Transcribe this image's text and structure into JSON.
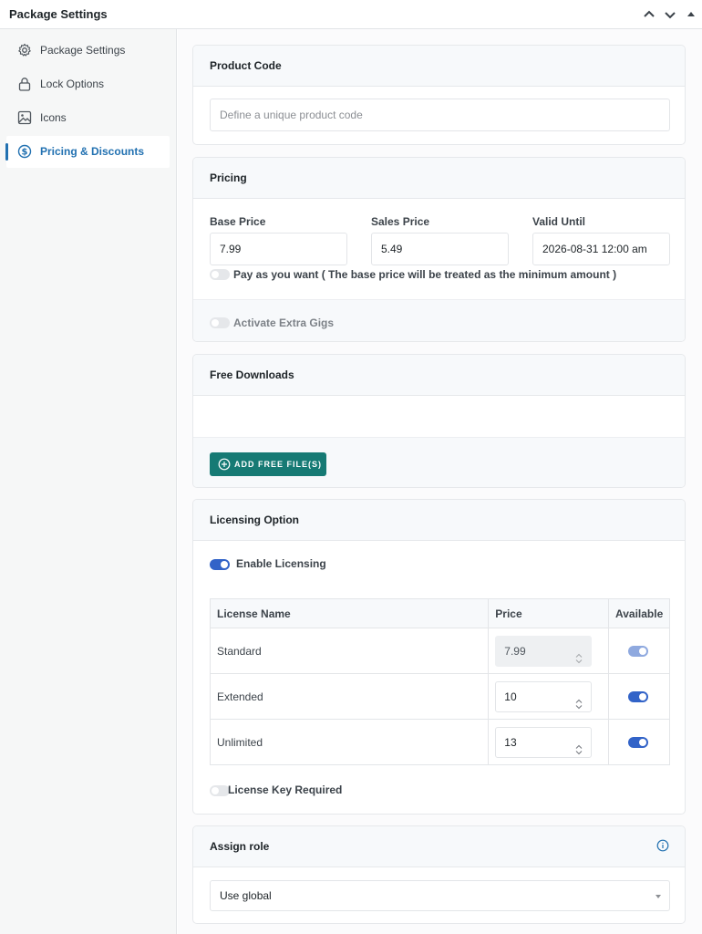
{
  "header": {
    "title": "Package Settings",
    "controls": [
      "chevron-up-icon",
      "chevron-down-icon",
      "triangle-up-icon"
    ]
  },
  "sidebar": {
    "items": [
      {
        "label": "Package Settings",
        "icon": "gear-icon",
        "active": false
      },
      {
        "label": "Lock Options",
        "icon": "lock-icon",
        "active": false
      },
      {
        "label": "Icons",
        "icon": "image-icon",
        "active": false
      },
      {
        "label": "Pricing & Discounts",
        "icon": "dollar-circle-icon",
        "active": true
      }
    ]
  },
  "product_code": {
    "heading": "Product Code",
    "placeholder": "Define a unique product code",
    "value": ""
  },
  "pricing": {
    "heading": "Pricing",
    "base_price_label": "Base Price",
    "base_price_value": "7.99",
    "sales_price_label": "Sales Price",
    "sales_price_value": "5.49",
    "valid_until_label": "Valid Until",
    "valid_until_value": "2026-08-31 12:00 am",
    "pay_as_you_want_label": "Pay as you want ( The base price will be treated as the minimum amount )",
    "pay_as_you_want_on": false,
    "extra_gigs_label": "Activate Extra Gigs",
    "extra_gigs_on": false
  },
  "free_downloads": {
    "heading": "Free Downloads",
    "add_button_label": "ADD FREE FILE(S)"
  },
  "licensing": {
    "heading": "Licensing Option",
    "enable_label": "Enable Licensing",
    "enable_on": true,
    "columns": [
      "License Name",
      "Price",
      "Available"
    ],
    "rows": [
      {
        "name": "Standard",
        "price": "7.99",
        "price_disabled": true,
        "available": true
      },
      {
        "name": "Extended",
        "price": "10",
        "price_disabled": false,
        "available": true
      },
      {
        "name": "Unlimited",
        "price": "13",
        "price_disabled": false,
        "available": true
      }
    ],
    "key_required_label": "License Key Required",
    "key_required_on": false
  },
  "assign_role": {
    "heading": "Assign role",
    "selected": "Use global"
  },
  "colors": {
    "accent": "#2271b1",
    "toggle_on": "#3263c8",
    "button_teal": "#167a74"
  }
}
